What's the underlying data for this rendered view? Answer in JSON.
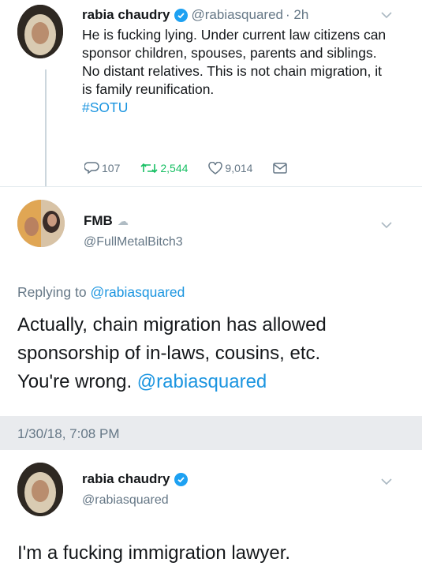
{
  "tweet1": {
    "name": "rabia chaudry",
    "handle": "@rabiasquared",
    "time": "· 2h",
    "text": "He is fucking lying.  Under current law citizens can sponsor children, spouses, parents and siblings. No distant relatives. This is not chain migration, it is family reunification.",
    "hashtag": "#SOTU",
    "replies": "107",
    "retweets": "2,544",
    "likes": "9,014"
  },
  "tweet2": {
    "name": "FMB",
    "handle": "@FullMetalBitch3",
    "replying_prefix": "Replying to",
    "replying_handle": "@rabiasquared",
    "text_line1": "Actually, chain migration has allowed",
    "text_line2": "sponsorship of in-laws, cousins, etc.",
    "text_line3_plain": "You're wrong. ",
    "text_line3_mention": "@rabiasquared",
    "timestamp": "1/30/18, 7:08 PM"
  },
  "tweet3": {
    "name": "rabia chaudry",
    "handle": "@rabiasquared",
    "text": "I'm a fucking immigration lawyer."
  },
  "colors": {
    "accent": "#1da1f2",
    "link": "#1b95e0",
    "secondary_text": "#657786",
    "retweet_green": "#17bf63"
  },
  "icons": {
    "reply": "reply-icon",
    "retweet": "retweet-icon",
    "like": "heart-icon",
    "dm": "mail-icon",
    "verified": "verified-badge-icon",
    "menu": "chevron-down-icon"
  }
}
